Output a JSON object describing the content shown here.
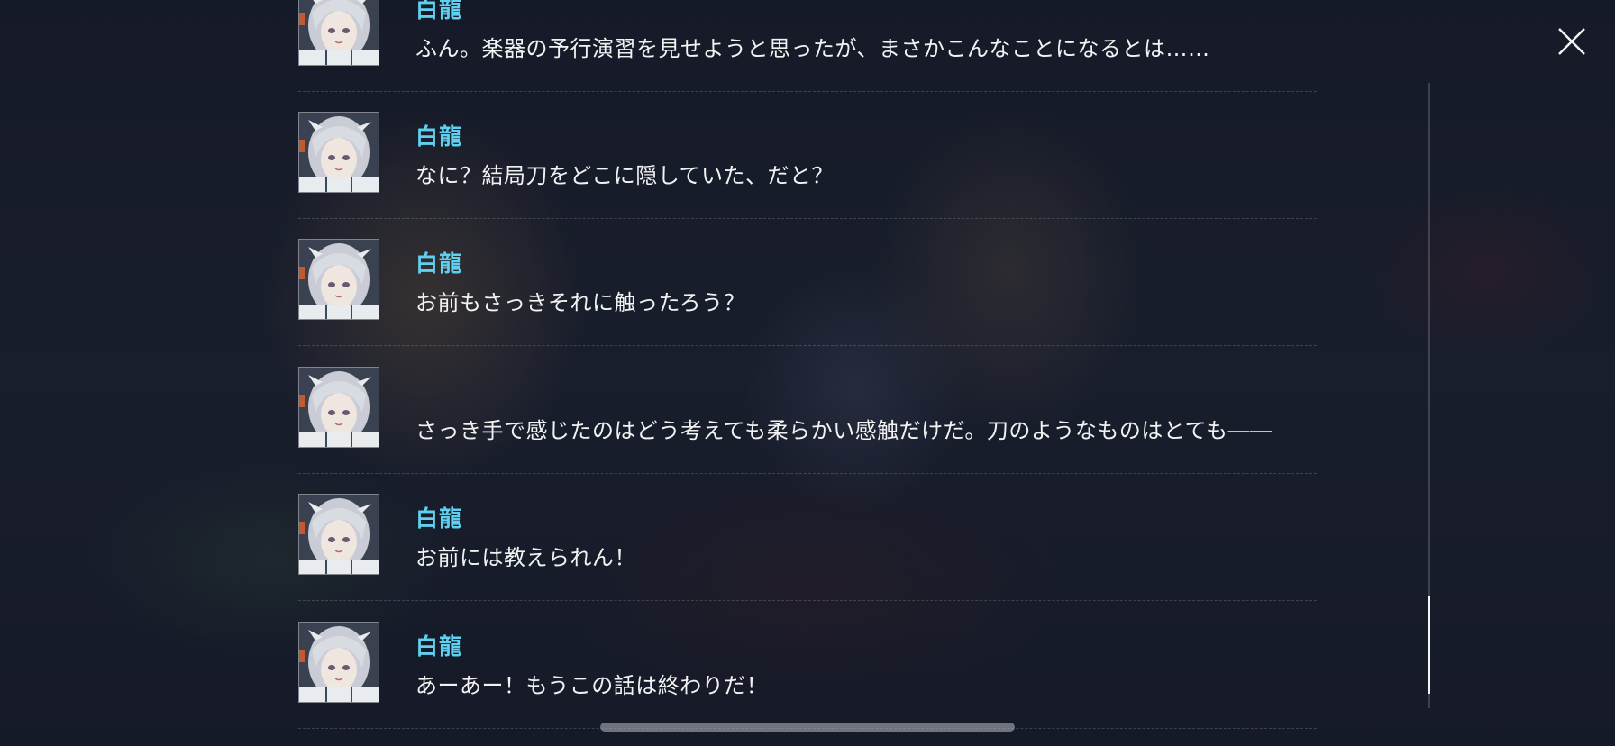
{
  "window": {
    "close_icon": "close-icon"
  },
  "colors": {
    "speaker": "#5fd0f0",
    "text": "#f2f2f2"
  },
  "log": [
    {
      "speaker": "白龍",
      "text": "ふん。楽器の予行演習を見せようと思ったが、まさかこんなことになるとは……",
      "avatar": "character-portrait"
    },
    {
      "speaker": "白龍",
      "text": "なに？結局刀をどこに隠していた、だと？",
      "avatar": "character-portrait"
    },
    {
      "speaker": "白龍",
      "text": "お前もさっきそれに触ったろう？",
      "avatar": "character-portrait"
    },
    {
      "speaker": "",
      "text": "さっき手で感じたのはどう考えても柔らかい感触だけだ。刀のようなものはとても――",
      "avatar": "character-portrait"
    },
    {
      "speaker": "白龍",
      "text": "お前には教えられん！",
      "avatar": "character-portrait"
    },
    {
      "speaker": "白龍",
      "text": "あーあー！もうこの話は終わりだ！",
      "avatar": "character-portrait"
    }
  ]
}
